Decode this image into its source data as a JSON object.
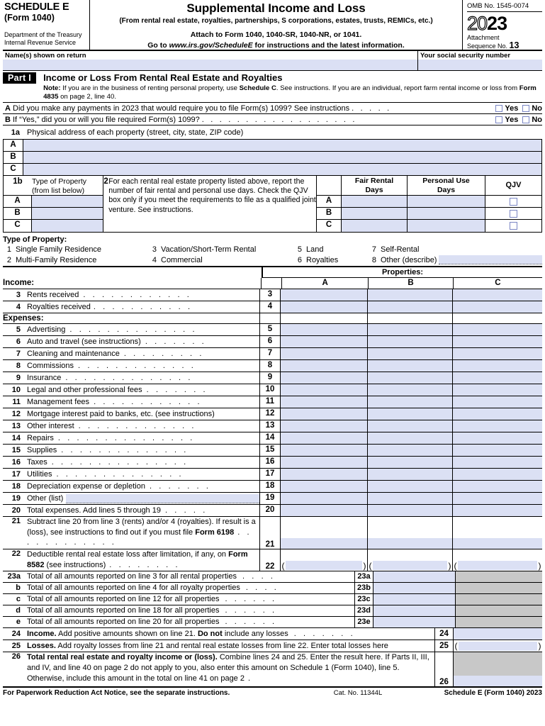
{
  "header": {
    "schedule": "SCHEDULE E",
    "form": "(Form 1040)",
    "dept_line1": "Department of the Treasury",
    "dept_line2": "Internal Revenue Service",
    "title": "Supplemental Income and Loss",
    "subtitle": "(From rental real estate, royalties, partnerships, S corporations, estates, trusts, REMICs, etc.)",
    "attach": "Attach to Form 1040, 1040-SR, 1040-NR, or 1041.",
    "goto_prefix": "Go to ",
    "goto_url": "www.irs.gov/ScheduleE",
    "goto_suffix": " for instructions and the latest information.",
    "omb": "OMB No. 1545-0074",
    "year_hollow": "20",
    "year_solid": "23",
    "attachment_label_1": "Attachment",
    "attachment_label_2": "Sequence No. ",
    "attachment_no": "13"
  },
  "name_row": {
    "name_label": "Name(s) shown on return",
    "name_value": "",
    "ssn_label": "Your social security number",
    "ssn_value": ""
  },
  "part1": {
    "part_box": "Part I",
    "title": "Income or Loss From Rental Real Estate and Royalties",
    "note_bold": "Note:",
    "note_text_1": " If you are in the business of renting personal property, use ",
    "note_bold_2": "Schedule C",
    "note_text_2": ". See instructions. If you are an individual, report farm rental income or loss from ",
    "note_bold_3": "Form 4835",
    "note_text_3": " on page 2, line 40."
  },
  "questions": [
    {
      "letter": "A",
      "text": "Did you make any payments in 2023 that would require you to file Form(s) 1099? See instructions",
      "dots": ".  .  .  .  .",
      "yes": "Yes",
      "no": "No",
      "yes_checked": false,
      "no_checked": false
    },
    {
      "letter": "B",
      "text": "If “Yes,” did you or will you file required Form(s) 1099?",
      "dots": ".  .  .  .  .  .  .  .  .  .  .  .  .  .  .  .  .  .",
      "yes": "Yes",
      "no": "No",
      "yes_checked": false,
      "no_checked": false
    }
  ],
  "line1a": {
    "num": "1a",
    "label": "Physical address of each property (street, city, state, ZIP code)",
    "rows": [
      {
        "letter": "A",
        "value": ""
      },
      {
        "letter": "B",
        "value": ""
      },
      {
        "letter": "C",
        "value": ""
      }
    ]
  },
  "line1b": {
    "num": "1b",
    "header_1": "Type of Property",
    "header_2": "(from list below)",
    "rows": [
      {
        "letter": "A",
        "value": ""
      },
      {
        "letter": "B",
        "value": ""
      },
      {
        "letter": "C",
        "value": ""
      }
    ]
  },
  "line2": {
    "num": "2",
    "text": "For each rental real estate property listed above, report the number of fair rental and personal use days. Check the QJV box only if you meet the requirements to file as a qualified joint venture. See instructions.",
    "col_fair_1": "Fair Rental",
    "col_fair_2": "Days",
    "col_personal_1": "Personal Use",
    "col_personal_2": "Days",
    "col_qjv": "QJV",
    "rows": [
      {
        "letter": "A",
        "fair": "",
        "personal": "",
        "qjv": false
      },
      {
        "letter": "B",
        "fair": "",
        "personal": "",
        "qjv": false
      },
      {
        "letter": "C",
        "fair": "",
        "personal": "",
        "qjv": false
      }
    ]
  },
  "type_of_property": {
    "title": "Type of Property:",
    "items": [
      {
        "n": "1",
        "label": "Single Family Residence"
      },
      {
        "n": "2",
        "label": "Multi-Family Residence"
      },
      {
        "n": "3",
        "label": "Vacation/Short-Term Rental"
      },
      {
        "n": "4",
        "label": "Commercial"
      },
      {
        "n": "5",
        "label": "Land"
      },
      {
        "n": "6",
        "label": "Royalties"
      },
      {
        "n": "7",
        "label": "Self-Rental"
      },
      {
        "n": "8",
        "label": "Other (describe)"
      }
    ],
    "other_value": ""
  },
  "grid": {
    "properties_label": "Properties:",
    "col_a": "A",
    "col_b": "B",
    "col_c": "C",
    "income_label": "Income:",
    "expenses_label": "Expenses:"
  },
  "income_lines": [
    {
      "n": "3",
      "label": "Rents received",
      "dots": ".   .   .   .   .   .   .   .   .   .   .   .",
      "box": "3",
      "a": "",
      "b": "",
      "c": ""
    },
    {
      "n": "4",
      "label": "Royalties received",
      "dots": ".   .   .   .   .   .   .   .   .   .   .",
      "box": "4",
      "a": "",
      "b": "",
      "c": ""
    }
  ],
  "expense_lines": [
    {
      "n": "5",
      "label": "Advertising",
      "dots": ".   .   .   .   .   .   .   .   .   .   .   .   .   .",
      "box": "5",
      "a": "",
      "b": "",
      "c": ""
    },
    {
      "n": "6",
      "label": "Auto and travel (see instructions)",
      "dots": ".   .   .   .   .   .   .",
      "box": "6",
      "a": "",
      "b": "",
      "c": ""
    },
    {
      "n": "7",
      "label": "Cleaning and maintenance",
      "dots": ".   .   .   .   .   .   .   .   .",
      "box": "7",
      "a": "",
      "b": "",
      "c": ""
    },
    {
      "n": "8",
      "label": "Commissions",
      "dots": ".   .   .   .   .   .   .   .   .   .   .   .   .",
      "box": "8",
      "a": "",
      "b": "",
      "c": ""
    },
    {
      "n": "9",
      "label": "Insurance",
      "dots": ".   .   .   .   .   .   .   .   .   .   .   .   .   .",
      "box": "9",
      "a": "",
      "b": "",
      "c": ""
    },
    {
      "n": "10",
      "label": "Legal and other professional fees",
      "dots": ".   .   .   .   .   .   .",
      "box": "10",
      "a": "",
      "b": "",
      "c": ""
    },
    {
      "n": "11",
      "label": "Management fees",
      "dots": ".   .   .   .   .   .   .   .   .   .   .   .",
      "box": "11",
      "a": "",
      "b": "",
      "c": ""
    },
    {
      "n": "12",
      "label": "Mortgage interest paid to banks, etc. (see instructions)",
      "dots": "",
      "box": "12",
      "a": "",
      "b": "",
      "c": ""
    },
    {
      "n": "13",
      "label": "Other interest",
      "dots": ".   .   .   .   .   .   .   .   .   .   .   .   .",
      "box": "13",
      "a": "",
      "b": "",
      "c": ""
    },
    {
      "n": "14",
      "label": "Repairs",
      "dots": ".   .   .   .   .   .   .   .   .   .   .   .   .   .   .",
      "box": "14",
      "a": "",
      "b": "",
      "c": ""
    },
    {
      "n": "15",
      "label": "Supplies",
      "dots": ".   .   .   .   .   .   .   .   .   .   .   .   .   .",
      "box": "15",
      "a": "",
      "b": "",
      "c": ""
    },
    {
      "n": "16",
      "label": "Taxes",
      "dots": ".   .   .   .   .   .   .   .   .   .   .   .   .   .   .",
      "box": "16",
      "a": "",
      "b": "",
      "c": ""
    },
    {
      "n": "17",
      "label": "Utilities",
      "dots": ".   .   .   .   .   .   .   .   .   .   .   .   .   .",
      "box": "17",
      "a": "",
      "b": "",
      "c": ""
    },
    {
      "n": "18",
      "label": "Depreciation expense or depletion",
      "dots": ".   .   .   .   .   .   .",
      "box": "18",
      "a": "",
      "b": "",
      "c": ""
    }
  ],
  "line19": {
    "n": "19",
    "label": "Other (list)",
    "box": "19",
    "value": "",
    "a": "",
    "b": "",
    "c": ""
  },
  "line20": {
    "n": "20",
    "label": "Total expenses. Add lines 5 through 19",
    "label_bold": "Total expenses.",
    "dots": ".   .   .   .   .",
    "box": "20",
    "a": "",
    "b": "",
    "c": ""
  },
  "line21": {
    "n": "21",
    "text_1": "Subtract line 20 from line 3 (rents) and/or 4 (royalties). If result is a (loss), see instructions to find out if you must file ",
    "bold": "Form 6198",
    "dots": ".   .   .   .   .   .   .   .   .   .   .   .",
    "box": "21",
    "a": "",
    "b": "",
    "c": ""
  },
  "line22": {
    "n": "22",
    "text_1": "Deductible rental real estate loss after limitation, if any, on ",
    "bold": "Form 8582",
    "text_2": " (see instructions)",
    "dots": ".   .   .   .   .   .   .   .",
    "box": "22",
    "a": "",
    "b": "",
    "c": ""
  },
  "line23": [
    {
      "n": "23a",
      "label": "Total of all amounts reported on line 3 for all rental properties",
      "dots": ".   .   .   .",
      "box": "23a",
      "value": ""
    },
    {
      "n": "b",
      "label": "Total of all amounts reported on line 4 for all royalty properties",
      "dots": ".   .   .   .",
      "box": "23b",
      "value": ""
    },
    {
      "n": "c",
      "label": "Total of all amounts reported on line 12 for all properties",
      "dots": ".   .   .   .   .   .",
      "box": "23c",
      "value": ""
    },
    {
      "n": "d",
      "label": "Total of all amounts reported on line 18 for all properties",
      "dots": ".   .   .   .   .   .",
      "box": "23d",
      "value": ""
    },
    {
      "n": "e",
      "label": "Total of all amounts reported on line 20 for all properties",
      "dots": ".   .   .   .   .   .",
      "box": "23e",
      "value": ""
    }
  ],
  "line24": {
    "n": "24",
    "bold": "Income.",
    "text": " Add positive amounts shown on line 21. ",
    "bold2": "Do not",
    "text2": " include any losses",
    "dots": ".   .   .   .   .   .   .",
    "box": "24",
    "value": ""
  },
  "line25": {
    "n": "25",
    "bold": "Losses.",
    "text": " Add royalty losses from line 21 and rental real estate losses from line 22. Enter total losses here",
    "box": "25",
    "value": ""
  },
  "line26": {
    "n": "26",
    "bold": "Total rental real estate and royalty income or (loss).",
    "text_1": " Combine lines 24 and 25. Enter the result here. If Parts II, III, and IV, and line 40 on page 2 do not apply to you, also enter this amount on Schedule 1 (Form 1040), line 5. Otherwise, include this amount in the total on line 41 on page 2",
    "dots": ".",
    "box": "26",
    "value": ""
  },
  "footer": {
    "left": "For Paperwork Reduction Act Notice, see the separate instructions.",
    "center": "Cat. No. 11344L",
    "right": "Schedule E (Form 1040) 2023"
  },
  "colors": {
    "field_fill": "#dbe0f4",
    "gray_fill": "#c8c8c8",
    "checkbox_border": "#7a86c4",
    "rule": "#000000"
  }
}
